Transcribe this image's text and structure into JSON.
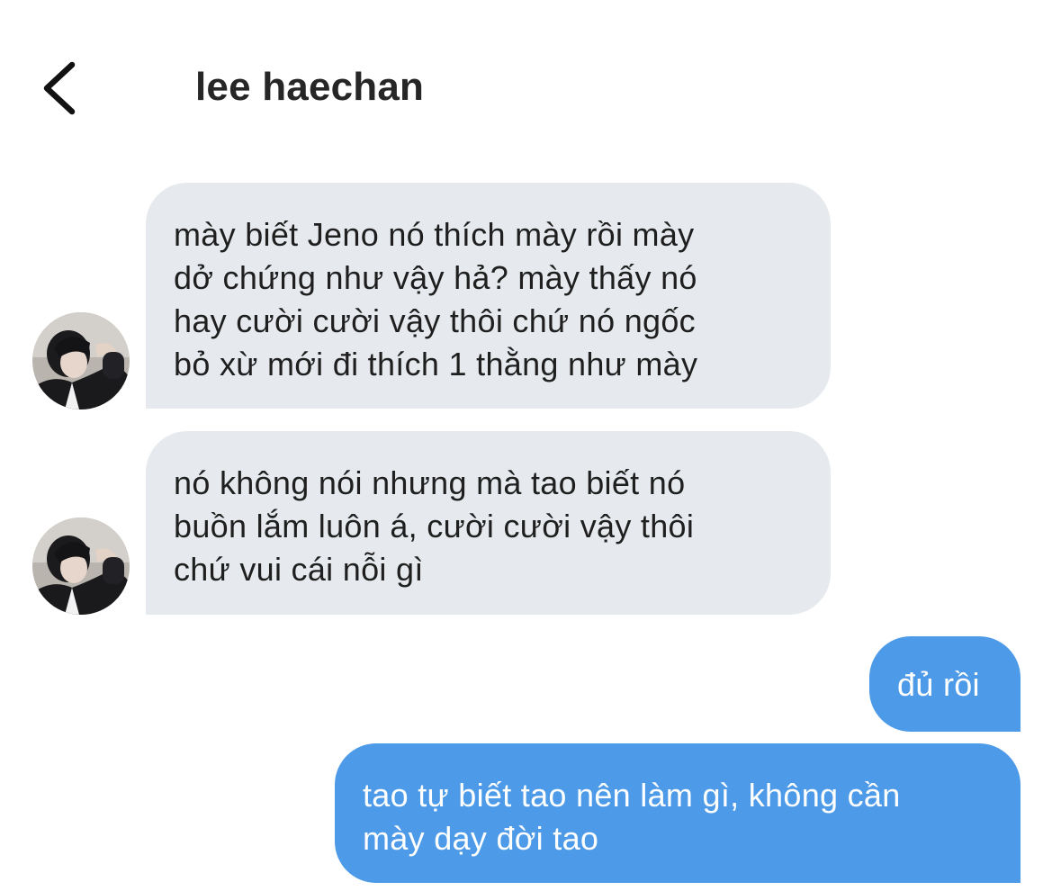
{
  "header": {
    "title": "lee haechan",
    "back_icon": "chevron-left-icon"
  },
  "contact": {
    "avatar_icon": "avatar-photo"
  },
  "colors": {
    "incoming_bubble": "#e6eaee",
    "outgoing_bubble": "#4d9ae8",
    "outgoing_text": "#ffffff",
    "incoming_text": "#1f1f1f"
  },
  "messages": [
    {
      "direction": "incoming",
      "lines": [
        "mày biết Jeno nó thích mày rồi mày",
        "dở chứng như vậy hả? mày thấy nó",
        "hay cười cười vậy thôi chứ nó ngốc",
        "bỏ xừ mới đi thích 1 thằng như mày"
      ]
    },
    {
      "direction": "incoming",
      "lines": [
        "nó không nói nhưng mà tao biết nó",
        "buồn lắm luôn á, cười cười vậy thôi",
        "chứ vui cái nỗi gì"
      ]
    },
    {
      "direction": "outgoing",
      "lines": [
        "đủ rồi"
      ]
    },
    {
      "direction": "outgoing",
      "lines": [
        "tao tự biết tao nên làm gì, không cần",
        "mày dạy đời tao"
      ]
    }
  ]
}
